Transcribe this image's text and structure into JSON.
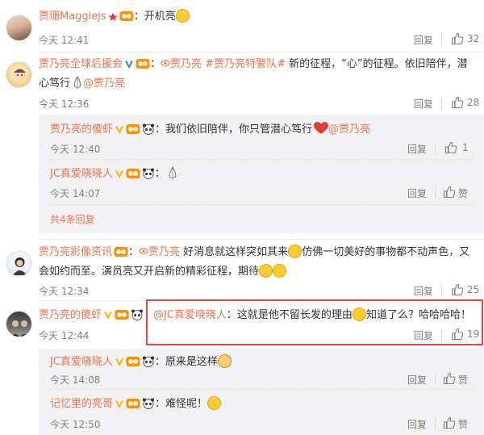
{
  "comments": [
    {
      "user": "贾珊Maggiejs",
      "text": "：开机亮",
      "time": "今天 12:41",
      "reply_label": "回复",
      "likes": "32"
    },
    {
      "user": "贾乃亮全球后援会",
      "text_line1": "：",
      "link1": "贾乃亮",
      "topic": "#贾乃亮特警队#",
      "text_mid": " 新的征程，“心”的征程。依旧陪伴，潜",
      "text_line2": "心笃行",
      "mention": "@贾乃亮",
      "time": "今天 12:36",
      "reply_label": "回复",
      "likes": "28",
      "replies": [
        {
          "user": "贾乃亮的傻虾",
          "text": "：我们依旧陪伴，你只管潜心笃行",
          "mention": "@贾乃亮",
          "time": "今天 12:40",
          "reply_label": "回复",
          "likes": "1"
        },
        {
          "user": "JC真爱晓晓人",
          "text": "：",
          "time": "今天 14:07",
          "reply_label": "回复",
          "likes": "赞"
        }
      ],
      "more_replies": "共4条回复"
    },
    {
      "user": "贾乃亮影像资讯",
      "text_line1": "：",
      "link1": "贾乃亮",
      "text_mid": " 好消息就这样突如其来",
      "text_after": "仿佛一切美好的事物都不动声色，又",
      "text_line2": "会如约而至。演员亮又开启新的精彩征程，期待",
      "time": "今天 12:34",
      "reply_label": "回复",
      "likes": "25"
    },
    {
      "user": "贾乃亮的傻虾",
      "mention": "@JC真爱晓晓人",
      "text": "：这就是他不留长发的理由",
      "text_after": "知道了么？哈哈哈哈！",
      "time": "今天 12:44",
      "reply_label": "回复",
      "likes": "19",
      "replies": [
        {
          "user": "JC真爱晓晓人",
          "text": "：原来是这样",
          "time": "今天 14:08",
          "reply_label": "回复",
          "likes": "赞"
        },
        {
          "user": "记忆里的亮哥",
          "text": "：难怪呢！",
          "time": "今天 12:50",
          "reply_label": "回复",
          "likes": "赞"
        }
      ]
    }
  ],
  "colors": {
    "username": "#eb7350",
    "highlight_border": "#e84545",
    "sub_bg": "#f2f2f5"
  }
}
